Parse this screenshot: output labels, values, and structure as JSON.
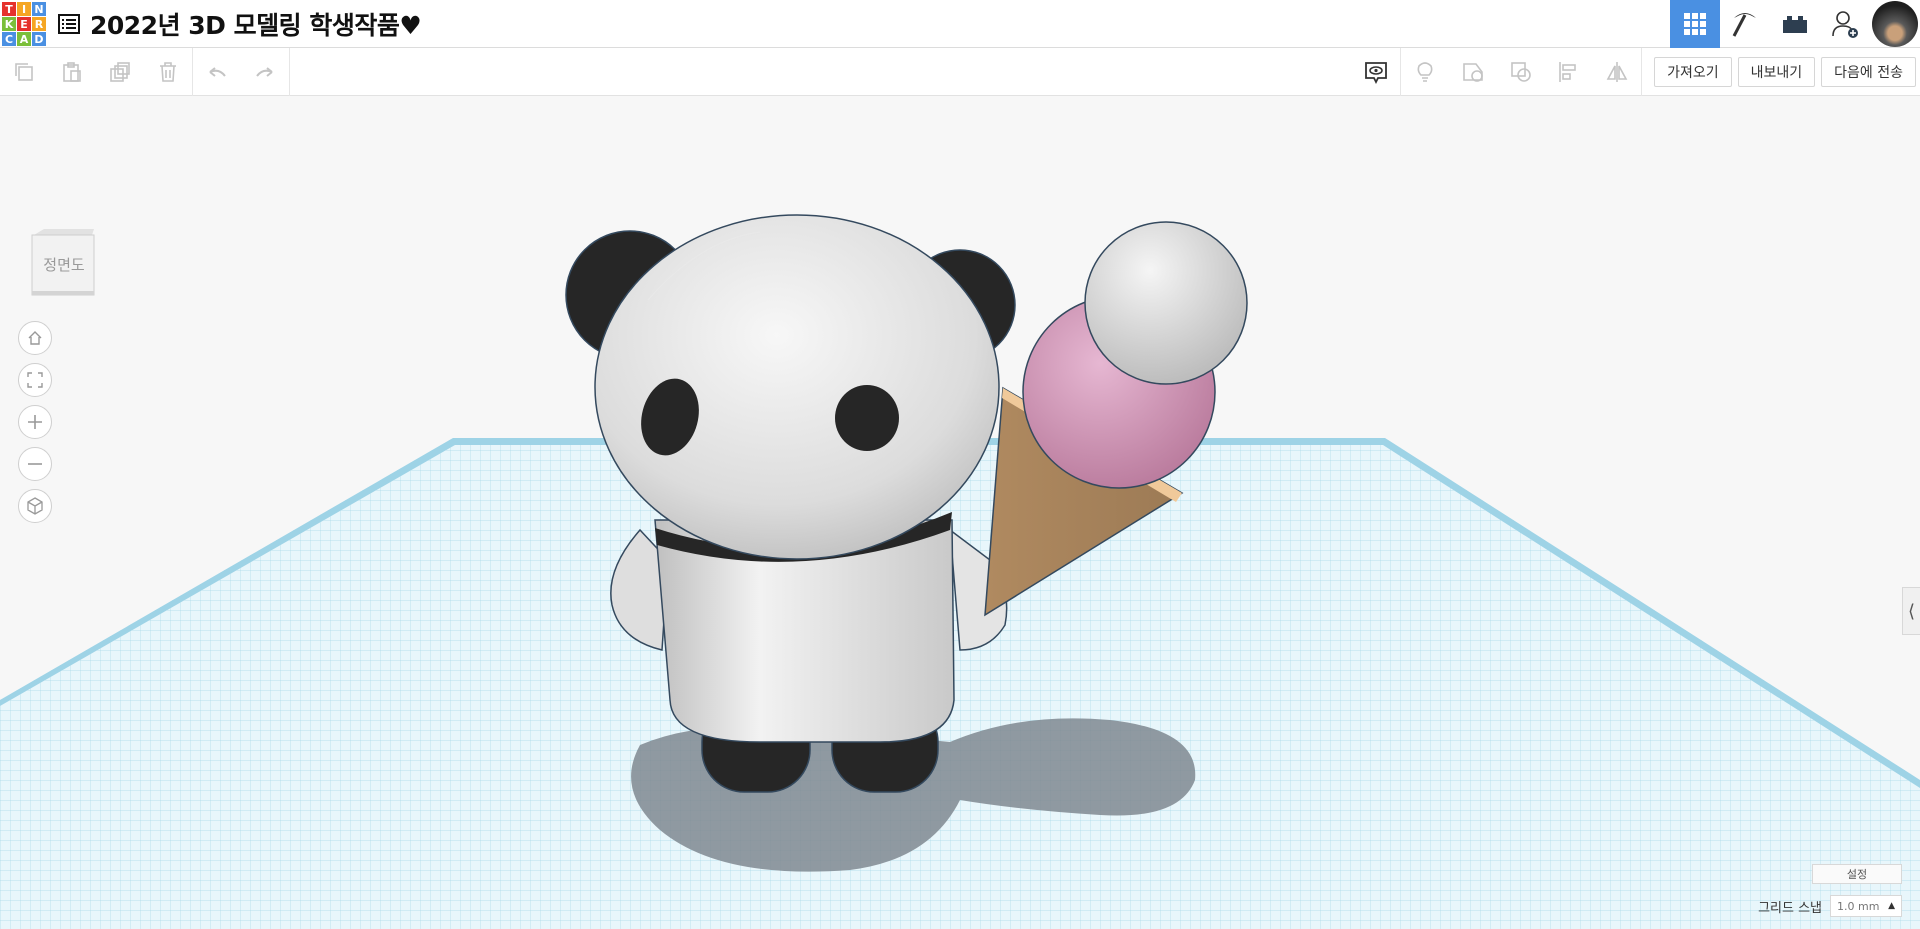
{
  "app": {
    "logo_letters": [
      "T",
      "I",
      "N",
      "K",
      "E",
      "R",
      "C",
      "A",
      "D"
    ],
    "logo_colors": [
      "#e5322d",
      "#f5a623",
      "#4a90e2",
      "#7bbf3a",
      "#e5322d",
      "#f5a623",
      "#4a90e2",
      "#7bbf3a",
      "#4a90e2"
    ],
    "title": "2022년 3D 모델링 학생작품♥",
    "accent": "#4a90e2"
  },
  "header_icons": [
    "grid-view-icon",
    "pickaxe-icon",
    "brick-icon",
    "add-user-icon",
    "avatar"
  ],
  "toolbar": {
    "left_tools": [
      "copy-icon",
      "paste-icon",
      "duplicate-icon",
      "delete-icon",
      "undo-icon",
      "redo-icon"
    ],
    "right_tools": [
      "notes-icon",
      "light-bulb-icon",
      "shape-icon",
      "group-icon",
      "align-icon",
      "mirror-icon"
    ],
    "import_label": "가져오기",
    "export_label": "내보내기",
    "send_to_label": "다음에 전송"
  },
  "view": {
    "cube_label": "정면도",
    "nav_controls": [
      "home-icon",
      "fit-view-icon",
      "zoom-in-icon",
      "zoom-out-icon",
      "perspective-icon"
    ]
  },
  "footer": {
    "settings_label": "설정",
    "grid_snap_label": "그리드 스냅",
    "grid_snap_value": "1.0 mm"
  }
}
